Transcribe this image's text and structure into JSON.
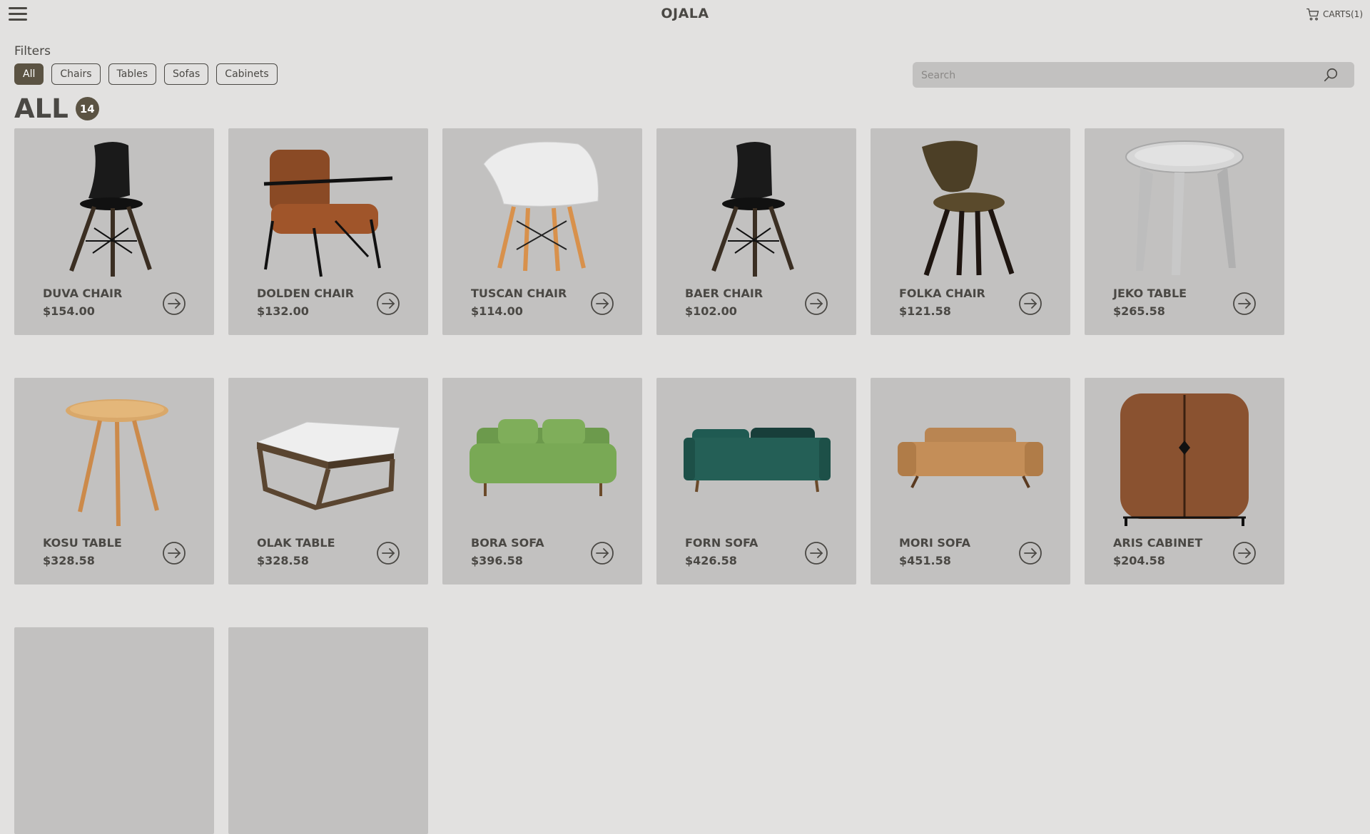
{
  "header": {
    "brand": "OJALA",
    "cart_label": "CARTS(1)"
  },
  "filters": {
    "title": "Filters",
    "options": [
      {
        "label": "All",
        "active": true
      },
      {
        "label": "Chairs",
        "active": false
      },
      {
        "label": "Tables",
        "active": false
      },
      {
        "label": "Sofas",
        "active": false
      },
      {
        "label": "Cabinets",
        "active": false
      }
    ]
  },
  "search": {
    "placeholder": "Search",
    "value": ""
  },
  "page": {
    "title": "ALL",
    "count": "14"
  },
  "colors": {
    "background": "#e2e1e0",
    "card": "#c2c1c0",
    "accent": "#5b5343",
    "text": "#4a4844"
  },
  "products": [
    {
      "name": "DUVA CHAIR",
      "price": "$154.00",
      "image": "black-shell-chair"
    },
    {
      "name": "DOLDEN CHAIR",
      "price": "$132.00",
      "image": "leather-armchair"
    },
    {
      "name": "TUSCAN CHAIR",
      "price": "$114.00",
      "image": "white-shell-armchair"
    },
    {
      "name": "BAER CHAIR",
      "price": "$102.00",
      "image": "black-shell-chair"
    },
    {
      "name": "FOLKA CHAIR",
      "price": "$121.58",
      "image": "olive-upholstered-chair"
    },
    {
      "name": "JEKO TABLE",
      "price": "$265.58",
      "image": "grey-tray-table"
    },
    {
      "name": "KOSU TABLE",
      "price": "$328.58",
      "image": "round-wood-side-table"
    },
    {
      "name": "OLAK TABLE",
      "price": "$328.58",
      "image": "marble-coffee-table"
    },
    {
      "name": "BORA SOFA",
      "price": "$396.58",
      "image": "green-sofa"
    },
    {
      "name": "FORN SOFA",
      "price": "$426.58",
      "image": "teal-velvet-sofa"
    },
    {
      "name": "MORI SOFA",
      "price": "$451.58",
      "image": "tan-leather-sofa"
    },
    {
      "name": "ARIS CABINET",
      "price": "$204.58",
      "image": "walnut-cabinet"
    },
    {
      "name": "",
      "price": "",
      "image": ""
    },
    {
      "name": "",
      "price": "",
      "image": ""
    }
  ]
}
